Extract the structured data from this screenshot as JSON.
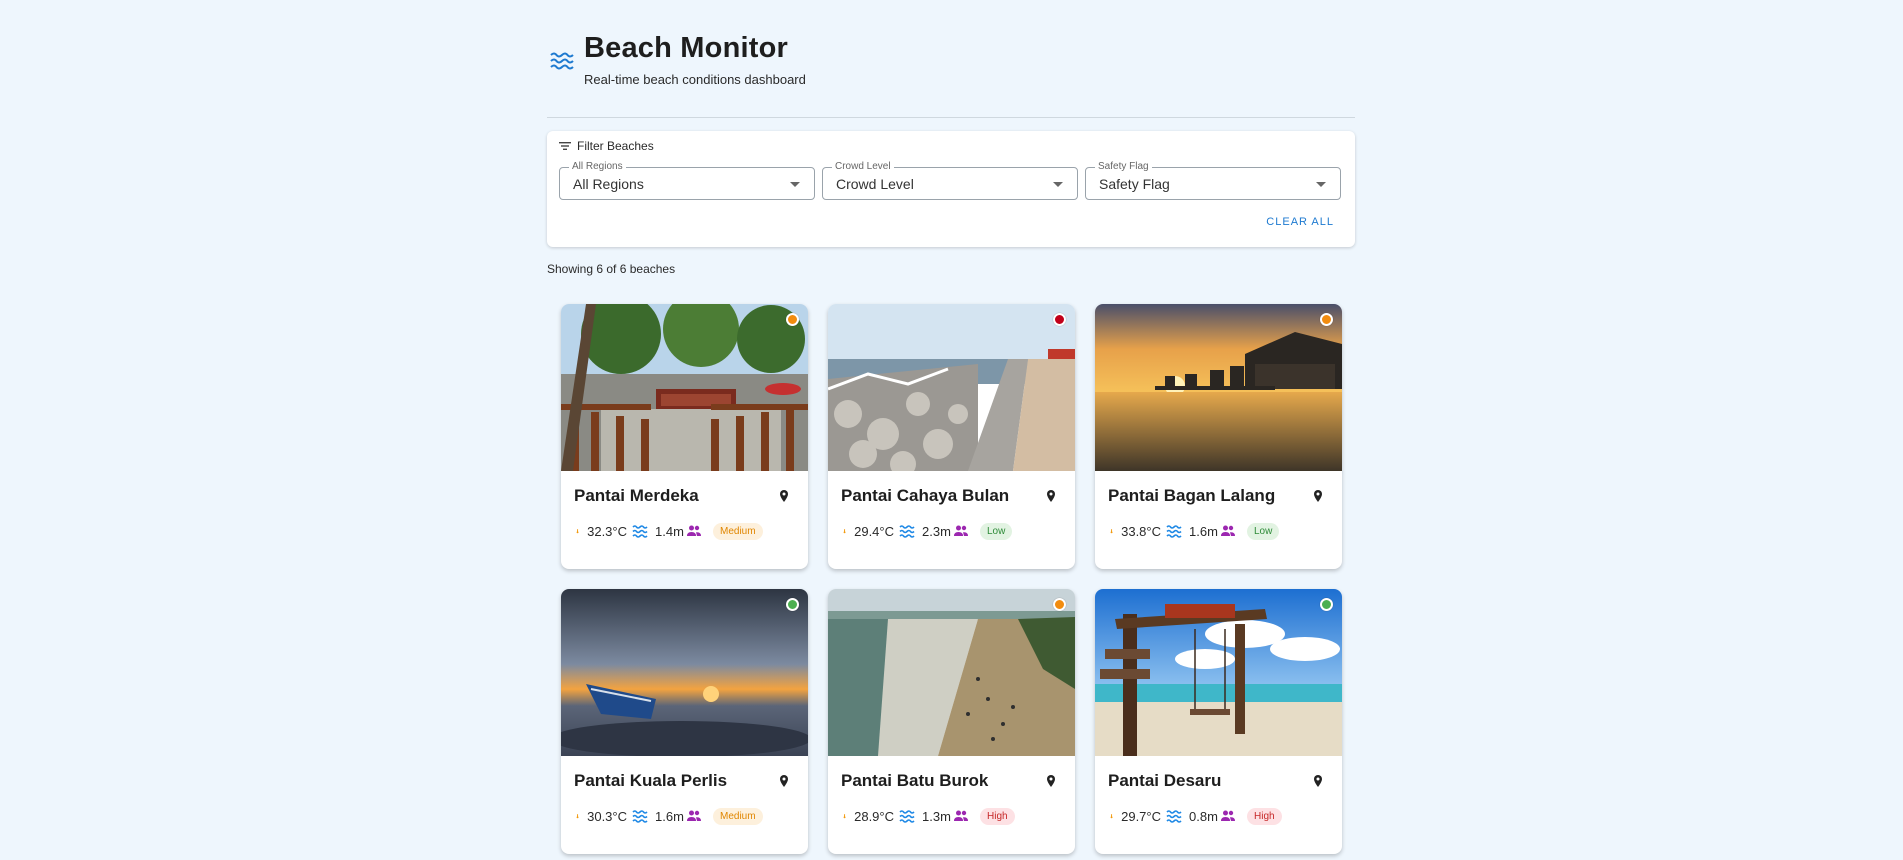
{
  "app": {
    "title": "Beach Monitor",
    "subtitle": "Real-time beach conditions dashboard"
  },
  "filters": {
    "heading": "Filter Beaches",
    "region": {
      "label": "All Regions",
      "value": "All Regions"
    },
    "crowd": {
      "label": "Crowd Level",
      "value": "Crowd Level"
    },
    "safety": {
      "label": "Safety Flag",
      "value": "Safety Flag"
    },
    "clear_label": "CLEAR ALL"
  },
  "showing_text": "Showing 6 of 6 beaches",
  "colors": {
    "accent": "#1e7ad0",
    "flag_orange": "#f28c0f",
    "flag_red": "#c2001a",
    "flag_green": "#4caf50"
  },
  "beaches": [
    {
      "name": "Pantai Merdeka",
      "temp": "32.3°C",
      "wave": "1.4m",
      "crowd": "Medium",
      "flag": "orange"
    },
    {
      "name": "Pantai Cahaya Bulan",
      "temp": "29.4°C",
      "wave": "2.3m",
      "crowd": "Low",
      "flag": "red"
    },
    {
      "name": "Pantai Bagan Lalang",
      "temp": "33.8°C",
      "wave": "1.6m",
      "crowd": "Low",
      "flag": "orange"
    },
    {
      "name": "Pantai Kuala Perlis",
      "temp": "30.3°C",
      "wave": "1.6m",
      "crowd": "Medium",
      "flag": "green"
    },
    {
      "name": "Pantai Batu Burok",
      "temp": "28.9°C",
      "wave": "1.3m",
      "crowd": "High",
      "flag": "orange"
    },
    {
      "name": "Pantai Desaru",
      "temp": "29.7°C",
      "wave": "0.8m",
      "crowd": "High",
      "flag": "green"
    }
  ]
}
